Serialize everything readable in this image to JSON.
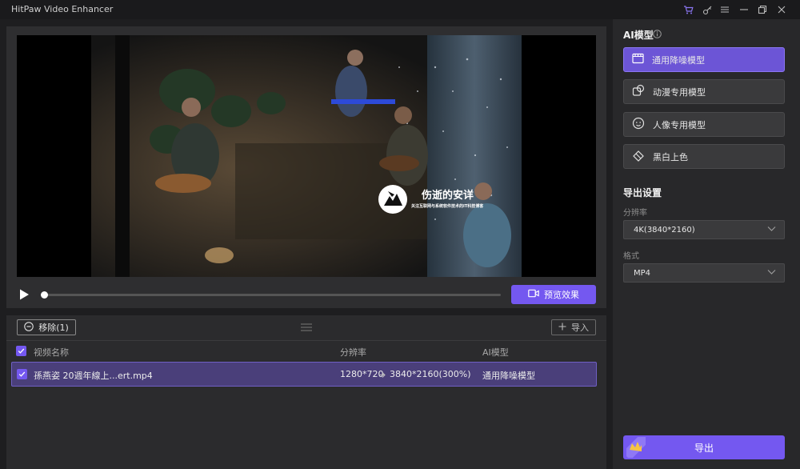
{
  "app": {
    "title": "HitPaw Video Enhancer"
  },
  "colors": {
    "accent": "#7458f0",
    "selected_row": "#4a3f7a",
    "background": "#1e1e20",
    "panel": "#2e2e30"
  },
  "titlebar_icons": [
    "cart-icon",
    "key-icon",
    "menu-icon",
    "minimize-icon",
    "restore-icon",
    "close-icon"
  ],
  "preview": {
    "watermark_title": "伤逝的安详",
    "watermark_subtitle": "关注互联网与系统软件技术的IT科技博客",
    "preview_button_label": "预览效果",
    "progress": 0
  },
  "list": {
    "remove_button_label": "移除(1)",
    "import_button_label": "导入",
    "columns": {
      "name": "视频名称",
      "resolution": "分辨率",
      "model": "AI模型"
    },
    "rows": [
      {
        "name": "孫燕姿 20週年線上...ert.mp4",
        "from_resolution": "1280*720",
        "to_resolution": "3840*2160(300%)",
        "model": "通用降噪模型",
        "selected": true
      }
    ]
  },
  "sidebar": {
    "ai_model_title": "AI模型",
    "models": [
      {
        "label": "通用降噪模型",
        "icon": "film-icon",
        "active": true
      },
      {
        "label": "动漫专用模型",
        "icon": "anime-icon",
        "active": false
      },
      {
        "label": "人像专用模型",
        "icon": "face-icon",
        "active": false
      },
      {
        "label": "黑白上色",
        "icon": "paint-bucket-icon",
        "active": false
      }
    ],
    "export_settings_title": "导出设置",
    "resolution_label": "分辨率",
    "resolution_value": "4K(3840*2160)",
    "format_label": "格式",
    "format_value": "MP4",
    "export_button_label": "导出"
  }
}
